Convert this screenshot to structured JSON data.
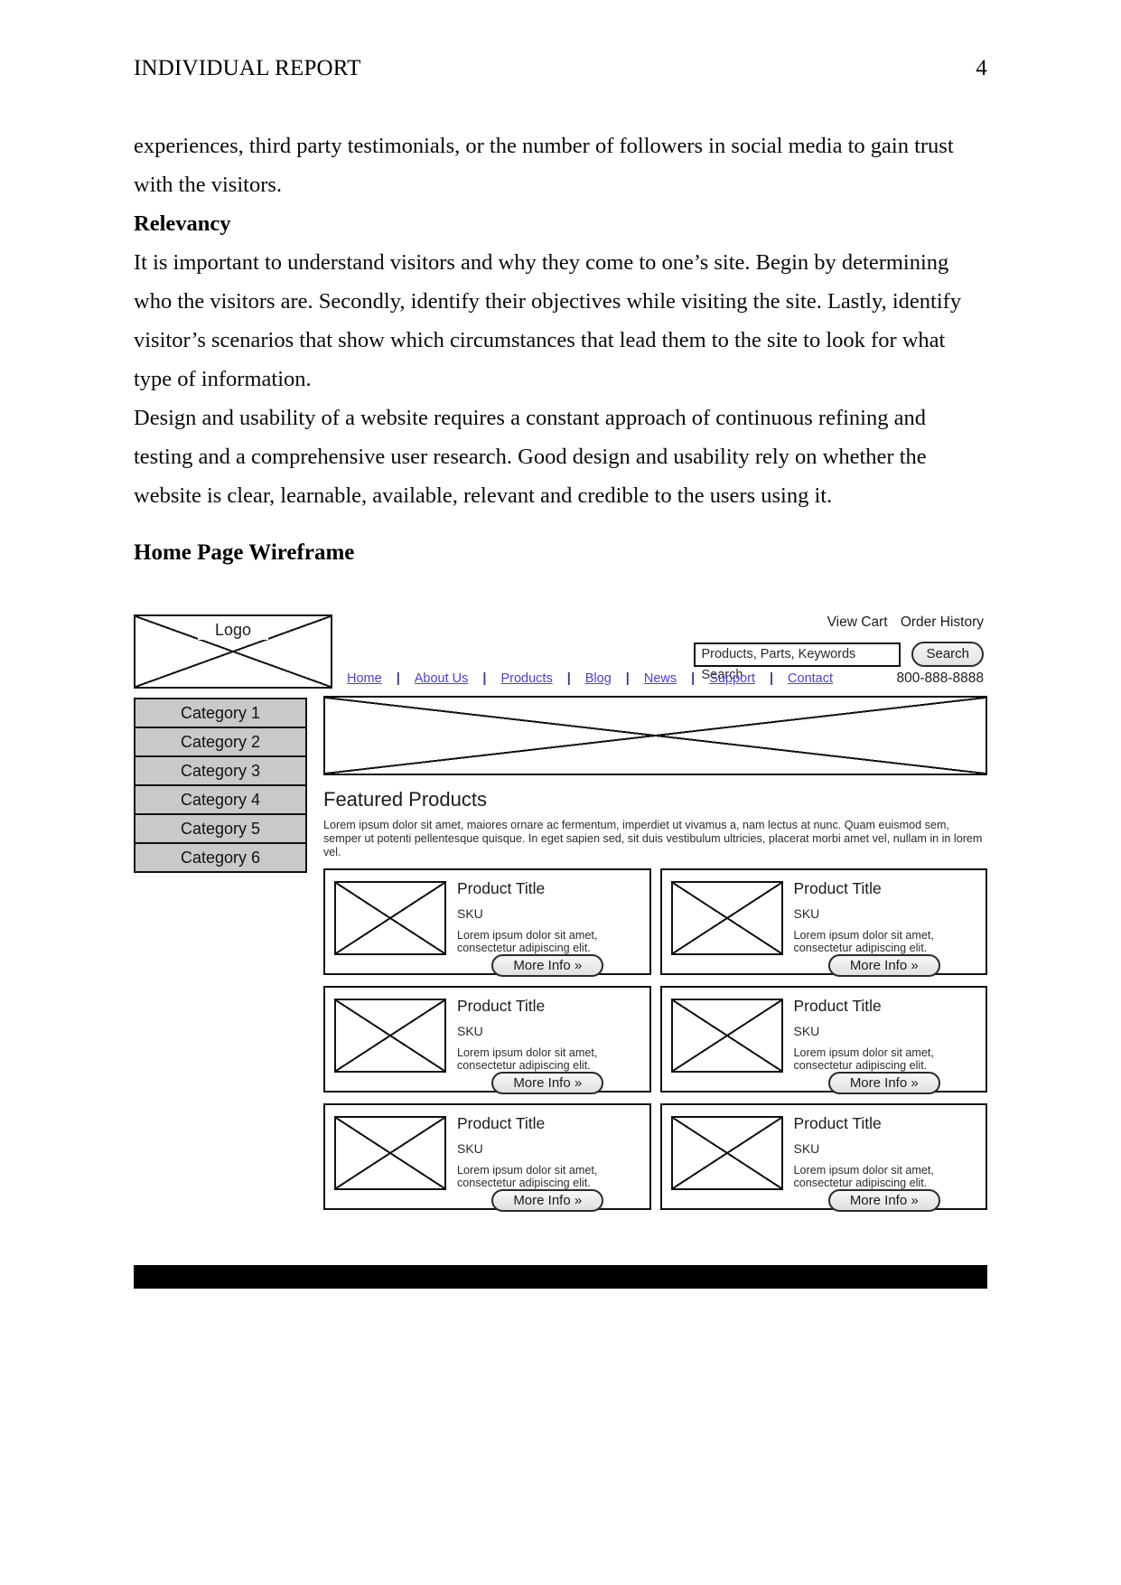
{
  "document": {
    "header_title": "INDIVIDUAL REPORT",
    "page_number": "4",
    "paragraphs": [
      "experiences, third party testimonials, or the number of followers in social media to gain trust with the visitors.",
      "It is important to understand visitors and why they come to one’s site. Begin by determining who the visitors are. Secondly, identify their objectives while visiting the site. Lastly, identify visitor’s scenarios that show which circumstances that lead them to the site to look for what type of information.",
      "Design and usability of a website requires a constant approach of continuous refining and testing and a comprehensive user research. Good design and usability rely on whether the website is clear, learnable, available, relevant and credible to the users using it."
    ],
    "subheading": "Relevancy",
    "section_heading": "Home Page Wireframe"
  },
  "wireframe": {
    "logo_label": "Logo",
    "utility_links": [
      "View Cart",
      "Order History"
    ],
    "search": {
      "value": "Products, Parts, Keywords Search",
      "button_label": "Search"
    },
    "nav": {
      "separator": "|",
      "items": [
        "Home",
        "About Us",
        "Products",
        "Blog",
        "News",
        "Support",
        "Contact"
      ],
      "phone": "800-888-8888"
    },
    "sidebar": {
      "categories": [
        "Category 1",
        "Category 2",
        "Category 3",
        "Category 4",
        "Category 5",
        "Category 6"
      ]
    },
    "content": {
      "featured_title": "Featured Products",
      "featured_description": "Lorem ipsum dolor sit amet, maiores ornare ac fermentum, imperdiet ut vivamus a, nam lectus at nunc. Quam euismod sem, semper ut potenti pellentesque quisque. In eget sapien sed, sit duis vestibulum ultricies, placerat morbi amet vel, nullam in in lorem vel.",
      "products": [
        {
          "title": "Product Title",
          "sku": "SKU",
          "description": "Lorem ipsum dolor sit amet, consectetur adipiscing elit.",
          "button_label": "More Info »"
        },
        {
          "title": "Product Title",
          "sku": "SKU",
          "description": "Lorem ipsum dolor sit amet, consectetur adipiscing elit.",
          "button_label": "More Info »"
        },
        {
          "title": "Product Title",
          "sku": "SKU",
          "description": "Lorem ipsum dolor sit amet, consectetur adipiscing elit.",
          "button_label": "More Info »"
        },
        {
          "title": "Product Title",
          "sku": "SKU",
          "description": "Lorem ipsum dolor sit amet, consectetur adipiscing elit.",
          "button_label": "More Info »"
        },
        {
          "title": "Product Title",
          "sku": "SKU",
          "description": "Lorem ipsum dolor sit amet, consectetur adipiscing elit.",
          "button_label": "More Info »"
        },
        {
          "title": "Product Title",
          "sku": "SKU",
          "description": "Lorem ipsum dolor sit amet, consectetur adipiscing elit.",
          "button_label": "More Info »"
        }
      ]
    },
    "colors": {
      "link": "#4a3fd6",
      "category_fill": "#c9c9c9",
      "footer": "#000000",
      "outline": "#111111"
    }
  }
}
